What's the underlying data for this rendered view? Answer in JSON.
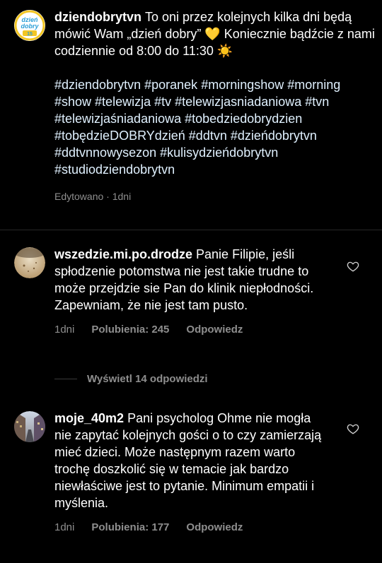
{
  "post": {
    "author": "dziendobrytvn",
    "text": "To oni przez kolejnych kilka dni będą mówić Wam „dzień dobry” 💛 Koniecznie bądźcie z nami codziennie od 8:00 do 11:30 ☀️",
    "hashtags": [
      "#dziendobrytvn",
      "#poranek",
      "#morningshow",
      "#morning",
      "#show",
      "#telewizja",
      "#tv",
      "#telewizjasniadaniowa",
      "#tvn",
      "#telewizjaśniadaniowa",
      "#tobedziedobrydzien",
      "#tobędzieDOBRYdzień",
      "#ddtvn",
      "#dzieńdobrytvn",
      "#ddtvnnowysezon",
      "#kulisydzieńdobrytvn",
      "#studiodziendobrytvn"
    ],
    "edited_label": "Edytowano",
    "separator": "·",
    "time": "1dni",
    "logo": {
      "line1": "dzień",
      "line2": "dobry",
      "badge": "15"
    }
  },
  "comments": [
    {
      "author": "wszedzie.mi.po.drodze",
      "text": "Panie Filipie, jeśli spłodzenie potomstwa nie jest takie trudne to może przejdzie sie Pan do klinik niepłodności. Zapewniam, że nie jest tam pusto.",
      "time": "1dni",
      "likes": "Polubienia: 245",
      "reply": "Odpowiedz",
      "view_replies": "Wyświetl 14 odpowiedzi"
    },
    {
      "author": "moje_40m2",
      "text": "Pani psycholog Ohme nie mogła nie zapytać kolejnych gości o to czy zamierzają mieć dzieci. Może następnym razem warto trochę doszkolić się w temacie jak bardzo niewłaściwe jest to pytanie. Minimum empatii i myślenia.",
      "time": "1dni",
      "likes": "Polubienia: 177",
      "reply": "Odpowiedz"
    }
  ],
  "colors": {
    "background": "#000000",
    "text": "#ffffff",
    "hashtag": "#e0f1ff",
    "muted": "#8e8e8e",
    "logo_blue": "#2c9fd7",
    "logo_yellow": "#f3c623"
  }
}
